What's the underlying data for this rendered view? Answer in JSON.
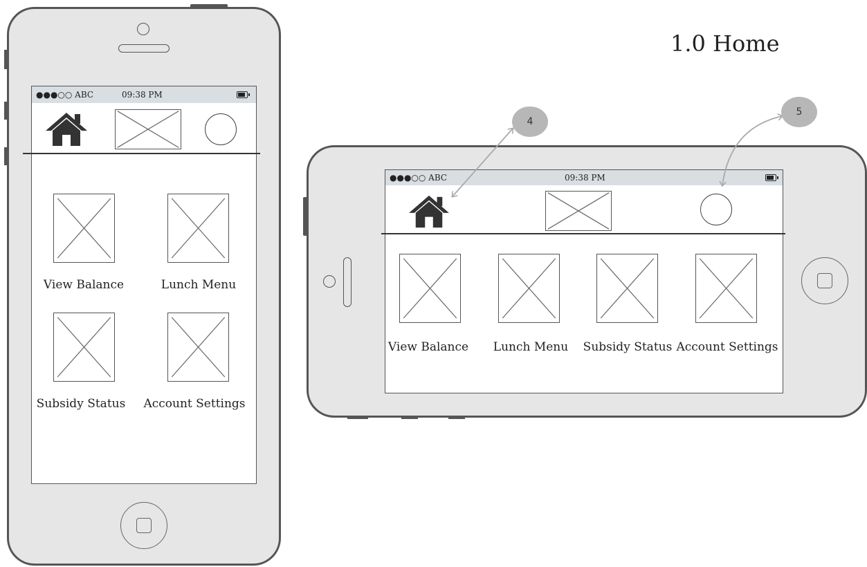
{
  "page_title": "1.0 Home",
  "status_bar": {
    "carrier": "●●●○○ ABC",
    "time": "09:38 PM"
  },
  "menu_items": [
    "View Balance",
    "Lunch Menu",
    "Subsidy Status",
    "Account Settings"
  ],
  "callouts": [
    "4",
    "5"
  ],
  "icons": {
    "home": "home-icon",
    "logo": "image-placeholder",
    "profile": "avatar-circle",
    "battery": "battery-icon",
    "home_button": "home-button"
  }
}
